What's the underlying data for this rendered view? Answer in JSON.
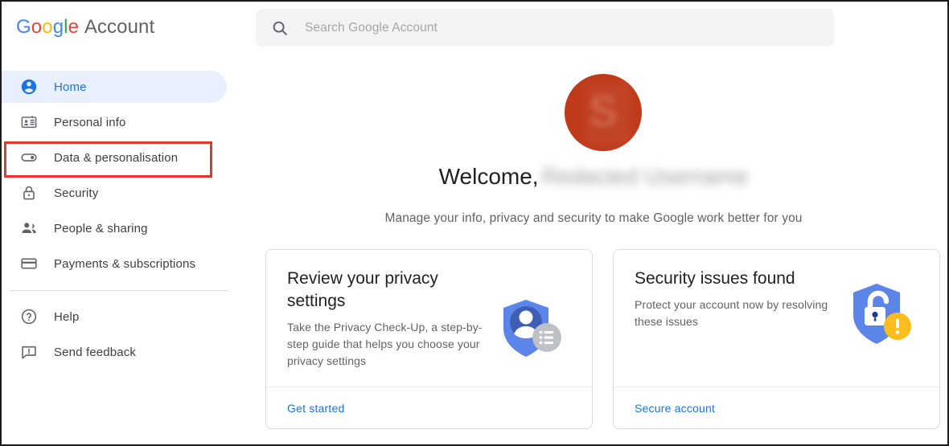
{
  "header": {
    "brand_google": "Google",
    "brand_word": "Account",
    "search": {
      "icon": "search-icon",
      "placeholder": "Search Google Account",
      "value": ""
    }
  },
  "sidebar": {
    "items": [
      {
        "id": "home",
        "label": "Home",
        "icon": "account-circle-icon",
        "selected": true
      },
      {
        "id": "personal-info",
        "label": "Personal info",
        "icon": "id-card-icon",
        "selected": false
      },
      {
        "id": "data-personalisation",
        "label": "Data & personalisation",
        "icon": "toggle-switch-icon",
        "selected": false
      },
      {
        "id": "security",
        "label": "Security",
        "icon": "lock-icon",
        "selected": false
      },
      {
        "id": "people-sharing",
        "label": "People & sharing",
        "icon": "people-icon",
        "selected": false
      },
      {
        "id": "payments-subscriptions",
        "label": "Payments & subscriptions",
        "icon": "credit-card-icon",
        "selected": false
      }
    ],
    "lower_items": [
      {
        "id": "help",
        "label": "Help",
        "icon": "help-circle-icon"
      },
      {
        "id": "send-feedback",
        "label": "Send feedback",
        "icon": "feedback-icon"
      }
    ]
  },
  "annotation": {
    "target": "Data & personalisation",
    "color": "#e8352a"
  },
  "main": {
    "avatar": {
      "icon": "user-avatar",
      "initial": "S",
      "color": "#bf3a1b",
      "redacted": true
    },
    "welcome_prefix": "Welcome,",
    "welcome_name": "Redacted Username",
    "subtitle": "Manage your info, privacy and security to make Google work better for you",
    "cards": [
      {
        "id": "privacy-checkup",
        "title": "Review your privacy settings",
        "description": "Take the Privacy Check-Up, a step-by-step guide that helps you choose your privacy settings",
        "link_label": "Get started",
        "icon": "privacy-shield-icon",
        "icon_colors": {
          "shield": "#5c85ea",
          "person": "#3f5eb5",
          "badge": "#bdc1c6"
        }
      },
      {
        "id": "security-issues",
        "title": "Security issues found",
        "description": "Protect your account now by resolving these issues",
        "link_label": "Secure account",
        "icon": "security-shield-warning-icon",
        "icon_colors": {
          "shield": "#5c85ea",
          "lock": "#ffffff",
          "keyhole": "#1b3a8f",
          "badge": "#f9be1d"
        }
      }
    ]
  },
  "colors": {
    "accent_blue": "#1a73e8",
    "selected_pill": "#e8f0fe",
    "text_primary": "#202124",
    "text_secondary": "#5f6368",
    "border": "#dadce0",
    "search_bg": "#f1f3f4"
  }
}
